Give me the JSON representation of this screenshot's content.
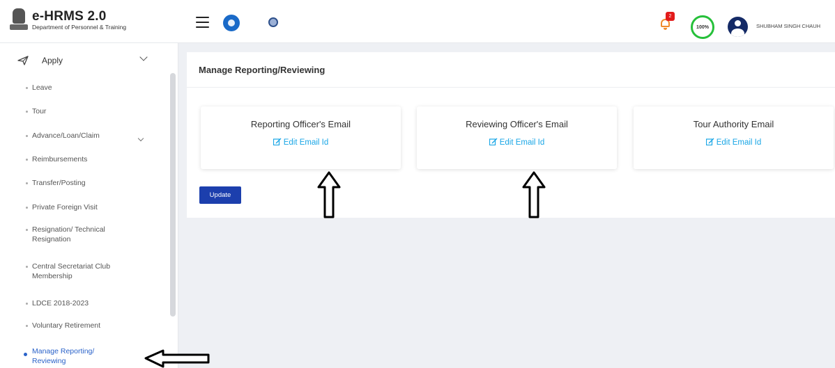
{
  "header": {
    "app_name": "e-HRMS 2.0",
    "department": "Department of Personnel & Training",
    "notification_count": "2",
    "profile_completion": "100%",
    "user_name": "SHUBHAM SINGH CHAUH"
  },
  "icons": {
    "menu": "hamburger-icon",
    "globe": "globe-icon",
    "chakra": "wheel-icon",
    "notifications": "bell-icon",
    "profile": "avatar-icon",
    "apply": "send-icon",
    "edit": "edit-icon"
  },
  "sidebar": {
    "section_label": "Apply",
    "items": [
      {
        "label": "Leave"
      },
      {
        "label": "Tour"
      },
      {
        "label": "Advance/Loan/Claim"
      },
      {
        "label": "Reimbursements"
      },
      {
        "label": "Transfer/Posting"
      },
      {
        "label": "Private Foreign Visit"
      },
      {
        "label": "Resignation/ Technical Resignation"
      },
      {
        "label": "Central Secretariat Club Membership"
      },
      {
        "label": "LDCE 2018-2023"
      },
      {
        "label": "Voluntary Retirement"
      },
      {
        "label": "Manage Reporting/ Reviewing"
      }
    ]
  },
  "main": {
    "title": "Manage Reporting/Reviewing",
    "cards": [
      {
        "title": "Reporting Officer's Email",
        "link": "Edit Email Id"
      },
      {
        "title": "Reviewing Officer's Email",
        "link": "Edit Email Id"
      },
      {
        "title": "Tour Authority Email",
        "link": "Edit Email Id"
      }
    ],
    "update_label": "Update"
  },
  "colors": {
    "accent": "#1c3fad",
    "link": "#19a6e6",
    "active_nav": "#2a62c9",
    "progress": "#26c03a",
    "badge": "#e21b1b"
  }
}
